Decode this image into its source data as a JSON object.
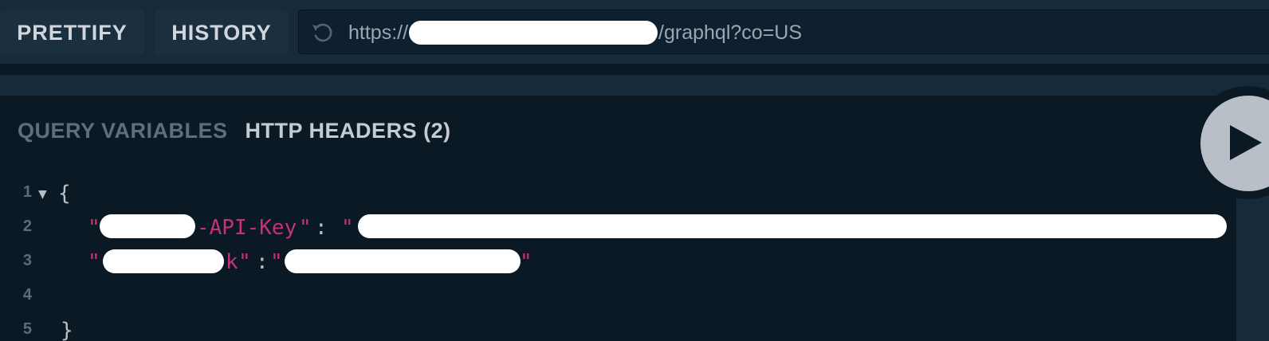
{
  "toolbar": {
    "prettify_label": "PRETTIFY",
    "history_label": "HISTORY",
    "reload_icon": "reload-icon",
    "url_prefix": "https://",
    "url_suffix": "/graphql?co=US"
  },
  "tabs": {
    "query_variables": "QUERY VARIABLES",
    "http_headers": "HTTP HEADERS (2)"
  },
  "play_icon": "play-icon",
  "editor": {
    "line_numbers": [
      "1",
      "2",
      "3",
      "4",
      "5"
    ],
    "fold_icon": "▼",
    "open_brace": "{",
    "close_brace": "}",
    "line2": {
      "key_quote_open": "\"",
      "key_visible": "-API-Key",
      "key_quote_close": "\"",
      "colon": ":",
      "value_quote_open": "\""
    },
    "line3": {
      "key_quote_open": "\"",
      "key_visible": "k",
      "key_quote_close": "\"",
      "colon": ":",
      "value_quote_open": "\"",
      "value_quote_close": "\""
    }
  },
  "colors": {
    "background": "#0b1924",
    "toolbar": "#172a3a",
    "json_key": "#c8307a"
  }
}
